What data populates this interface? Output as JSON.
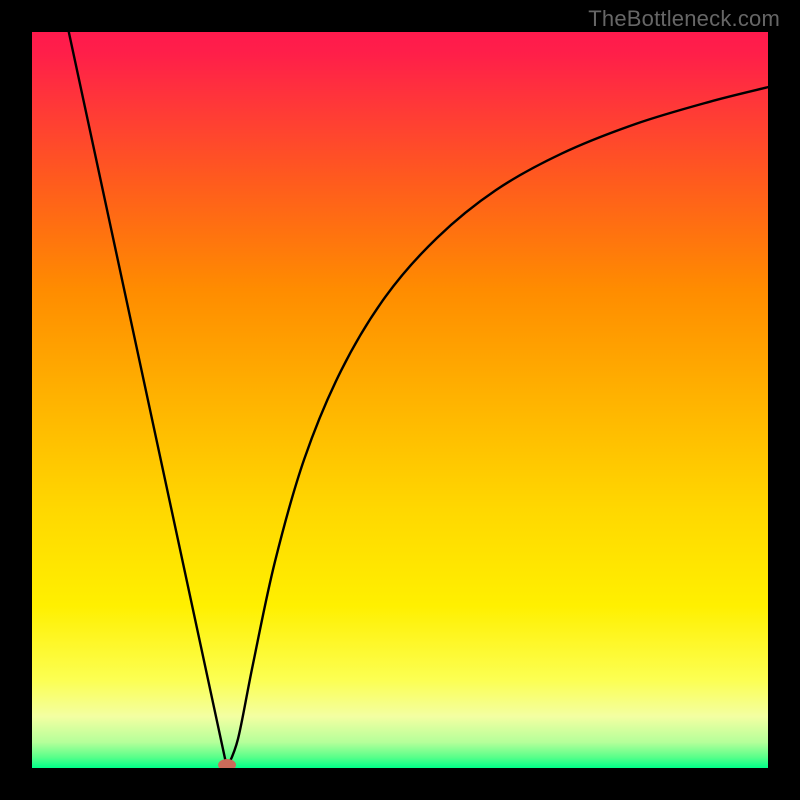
{
  "watermark": "TheBottleneck.com",
  "chart_data": {
    "type": "line",
    "title": "",
    "xlabel": "",
    "ylabel": "",
    "xlim": [
      0,
      100
    ],
    "ylim": [
      0,
      100
    ],
    "gradient_stops": [
      {
        "offset": 0.0,
        "color": "#ff1a4d"
      },
      {
        "offset": 0.03,
        "color": "#ff1f49"
      },
      {
        "offset": 0.1,
        "color": "#ff3838"
      },
      {
        "offset": 0.2,
        "color": "#ff5a1e"
      },
      {
        "offset": 0.35,
        "color": "#ff8c00"
      },
      {
        "offset": 0.5,
        "color": "#ffb300"
      },
      {
        "offset": 0.65,
        "color": "#ffd800"
      },
      {
        "offset": 0.78,
        "color": "#fff000"
      },
      {
        "offset": 0.88,
        "color": "#fcff52"
      },
      {
        "offset": 0.93,
        "color": "#f3ffa2"
      },
      {
        "offset": 0.965,
        "color": "#b5ff9a"
      },
      {
        "offset": 0.985,
        "color": "#5aff8a"
      },
      {
        "offset": 1.0,
        "color": "#00ff88"
      }
    ],
    "curve": {
      "left_branch": {
        "x": [
          5,
          26.5
        ],
        "y": [
          100,
          0
        ]
      },
      "valley": {
        "x": 26.5,
        "y": 0
      },
      "right_branch_points": [
        {
          "x": 26.5,
          "y": 0
        },
        {
          "x": 28.0,
          "y": 4
        },
        {
          "x": 30.0,
          "y": 14
        },
        {
          "x": 33.0,
          "y": 28
        },
        {
          "x": 37.0,
          "y": 42
        },
        {
          "x": 42.0,
          "y": 54
        },
        {
          "x": 48.0,
          "y": 64
        },
        {
          "x": 55.0,
          "y": 72
        },
        {
          "x": 63.0,
          "y": 78.5
        },
        {
          "x": 72.0,
          "y": 83.5
        },
        {
          "x": 82.0,
          "y": 87.5
        },
        {
          "x": 92.0,
          "y": 90.5
        },
        {
          "x": 100.0,
          "y": 92.5
        }
      ]
    },
    "marker": {
      "x": 26.5,
      "y": 0,
      "color": "#cc6b5a",
      "rx": 9,
      "ry": 6
    }
  }
}
